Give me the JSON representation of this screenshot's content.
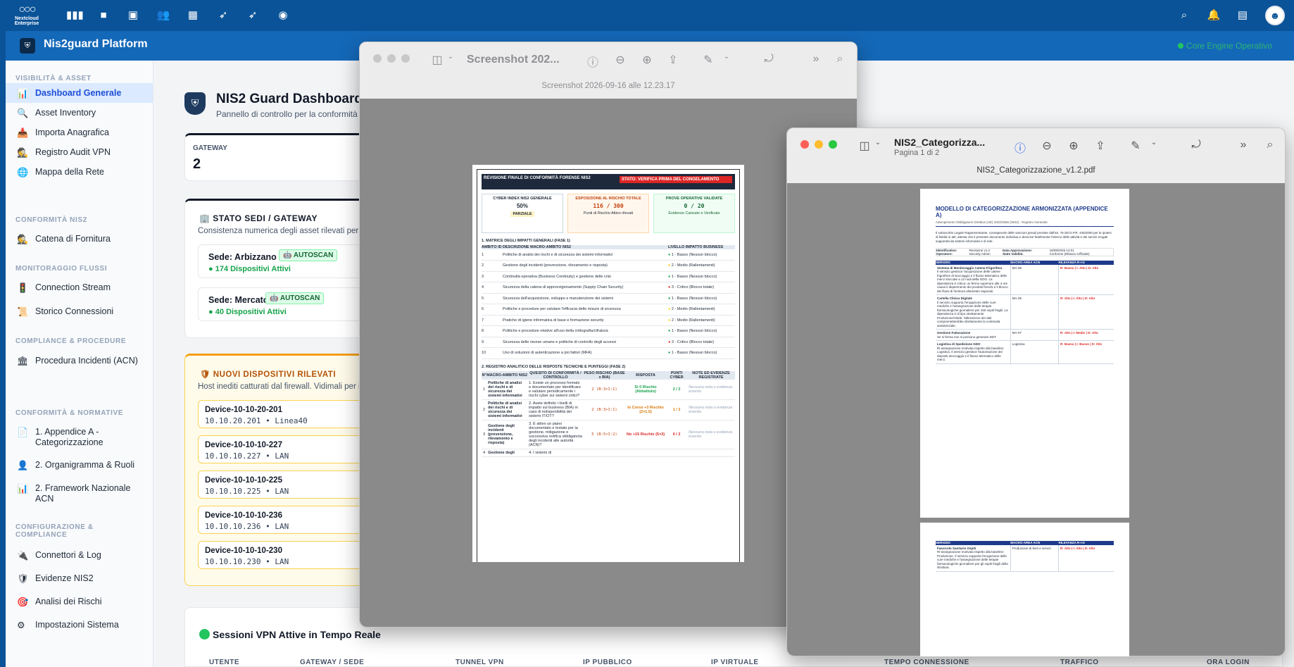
{
  "topbar": {
    "brand_line1": "Nextcloud",
    "brand_line2": "Enterprise"
  },
  "app": {
    "title": "Nis2guard Platform",
    "status": "Core Engine Operativo"
  },
  "sidebar": {
    "sections": [
      "VISIBILITÀ & ASSET",
      "CONFORMITÀ NIS2",
      "MONITORAGGIO FLUSSI",
      "COMPLIANCE & PROCEDURE",
      "CONFORMITÀ & NORMATIVE",
      "CONFIGURAZIONE & COMPLIANCE"
    ],
    "items": [
      "Dashboard Generale",
      "Asset Inventory",
      "Importa Anagrafica",
      "Registro Audit VPN",
      "Mappa della Rete",
      "Catena di Fornitura",
      "Connection Stream",
      "Storico Connessioni",
      "Procedura Incidenti (ACN)",
      "1. Appendice A - Categorizzazione",
      "2. Organigramma & Ruoli",
      "2. Framework Nazionale ACN",
      "Connettori & Log",
      "Evidenze NIS2",
      "Analisi dei Rischi",
      "Impostazioni Sistema"
    ]
  },
  "dashboard": {
    "title": "NIS2 Guard Dashboard",
    "subtitle": "Pannello di controllo per la conformità",
    "gateway_label": "GATEWAY",
    "gateway_value": "2",
    "stato_title": "STATO SEDI / GATEWAY",
    "stato_sub": "Consistenza numerica degli asset rilevati per o",
    "sedi": [
      {
        "name": "Sede: Arbizzano",
        "badge": "AUTOSCAN",
        "count": "174 Dispositivi Attivi"
      },
      {
        "name": "Sede: Mercato",
        "badge": "AUTOSCAN",
        "count": "40 Dispositivi Attivi"
      }
    ],
    "new_title": "NUOVI DISPOSITIVI RILEVATI",
    "new_sub": "Host inediti catturati dal firewall. Vidimali per i",
    "devices": [
      {
        "name": "Device-10-10-20-201",
        "ip": "10.10.20.201 • Linea40"
      },
      {
        "name": "Device-10-10-10-227",
        "ip": "10.10.10.227 • LAN"
      },
      {
        "name": "Device-10-10-10-225",
        "ip": "10.10.10.225 • LAN"
      },
      {
        "name": "Device-10-10-10-236",
        "ip": "10.10.10.236 • LAN"
      },
      {
        "name": "Device-10-10-10-230",
        "ip": "10.10.10.230 • LAN"
      }
    ],
    "vpn_title": "Sessioni VPN Attive in Tempo Reale",
    "vpn_cols": [
      "UTENTE",
      "GATEWAY / SEDE",
      "TUNNEL VPN",
      "IP PUBBLICO",
      "IP VIRTUALE",
      "TEMPO CONNESSIONE",
      "TRAFFICO",
      "ORA LOGIN"
    ]
  },
  "preview1": {
    "title": "Screenshot 202...",
    "subtitle": "Screenshot 2026-09-16 alle 12.23.17",
    "doc": {
      "header": "REVISIONE FINALE DI CONFORMITÀ FORENSE NIS2",
      "state": "STATO: VERIFICA PRIMA DEL CONGELAMENTO",
      "kpi": [
        {
          "title": "CYBER INDEX NIS2 GENERALE",
          "value": "50%",
          "note": "PARZIALE"
        },
        {
          "title": "ESPOSIZIONE AL RISCHIO TOTALE",
          "value": "116 / 300",
          "note": "Punti di Rischio Attivo rilevati"
        },
        {
          "title": "PROVE OPERATIVE VALIDATE",
          "value": "0 / 20",
          "note": "Evidenze Caricate e Verificate"
        }
      ],
      "s1_title": "1. MATRICE DEGLI IMPATTI GENERALI (FASE 1)",
      "s1_cols": [
        "AMBITO ID",
        "DESCRIZIONE MACRO-AMBITO NIS2",
        "LIVELLO IMPATTO BUSINESS"
      ],
      "s1_rows": [
        [
          "1",
          "Politiche di analisi dei rischi e di sicurezza dei sistemi informativi",
          "1 - Basso (Nessun blocco)"
        ],
        [
          "2",
          "Gestione degli incidenti (prevenzione, rilevamento e risposta)",
          "2 - Medio (Rallentamenti)"
        ],
        [
          "3",
          "Continuità operativa (Business Continuity) e gestione delle crisi",
          "1 - Basso (Nessun blocco)"
        ],
        [
          "4",
          "Sicurezza della catena di approvvigionamento (Supply Chain Security)",
          "3 - Critico (Blocco totale)"
        ],
        [
          "5",
          "Sicurezza dell'acquisizione, sviluppo e manutenzione dei sistemi",
          "1 - Basso (Nessun blocco)"
        ],
        [
          "6",
          "Politiche e procedure per valutare l'efficacia delle misure di sicurezza",
          "2 - Medio (Rallentamenti)"
        ],
        [
          "7",
          "Pratiche di igiene informatica di base e formazione security",
          "2 - Medio (Rallentamenti)"
        ],
        [
          "8",
          "Politiche e procedure relative all'uso della crittografia/cifratura",
          "1 - Basso (Nessun blocco)"
        ],
        [
          "9",
          "Sicurezza delle risorse umane e politiche di controllo degli accessi",
          "3 - Critico (Blocco totale)"
        ],
        [
          "10",
          "Uso di soluzioni di autenticazione a più fattori (MFA)",
          "1 - Basso (Nessun blocco)"
        ]
      ],
      "s2_title": "2. REGISTRO ANALITICO DELLE RISPOSTE TECNICHE E PUNTEGGI (FASE 2)",
      "s2_cols": [
        "N°",
        "MACRO-AMBITO NIS2",
        "QUESITO DI CONFORMITÀ / CONTROLLO",
        "PESO RISCHIO (BASE x BIA)",
        "RISPOSTA",
        "PUNTI CYBER",
        "NOTE ED EVIDENZE REGISTRATE"
      ],
      "s2_rows": [
        [
          "1",
          "Politiche di analisi dei rischi e di sicurezza dei sistemi informativi",
          "1. Esiste un processo formale e documentato per identificare e valutare periodicamente i rischi cyber sui sistemi critici?",
          "2 (B:3×I:1)",
          "Sì 0 Rischio (Abbattuto)",
          "2 / 2",
          "Nessuna nota o evidenza inserita"
        ],
        [
          "2",
          "Politiche di analisi dei rischi e di sicurezza dei sistemi informativi",
          "2. Avete definito i livelli di impatto sul business (BIA) in caso di indisponibilità dei sistemi IT/OT?",
          "2 (B:3×I:1)",
          "In Corso +3 Rischio (2×1.5)",
          "1 / 2",
          "Nessuna nota o evidenza inserita"
        ],
        [
          "3",
          "Gestione degli incidenti (prevenzione, rilevamento e risposta)",
          "3. È attivo un piano documentato e testato per la gestione, mitigazione e successiva notifica obbligatoria degli incidenti alle autorità (ACN)?",
          "5 (B:5×I:2)",
          "No +15 Rischio (5×3)",
          "0 / 2",
          "Nessuna nota o evidenza inserita"
        ],
        [
          "4",
          "Gestione degli",
          "4. I sistemi di",
          "",
          "",
          "",
          ""
        ]
      ]
    }
  },
  "preview2": {
    "title": "NIS2_Categorizza...",
    "subtitle": "Pagina 1 di 2",
    "filename": "NIS2_Categorizzazione_v1.2.pdf",
    "doc": {
      "title": "MODELLO DI CATEGORIZZAZIONE ARMONIZZATA (APPENDICE A)",
      "subtitle": "Adempimento Obbligatorio Direttiva (UE) 2022/2555 (NIS2) - Registro Generale",
      "intro": "Il sottoscritto Legale Rappresentante, consapevole delle sanzioni penali previste dall'art. 76 del D.P.R. 445/2000 per le ipotesi di falsità in atti, attesta che il presente documento individua e descrive fedelmente l'elenco delle attività e dei servizi erogati supportati da sistemi informativi e di rete.",
      "meta": [
        [
          "Identificativo:",
          "Revisione v1.2",
          "Data Approvazione:",
          "15/09/2026 14:01"
        ],
        [
          "Operatore:",
          "Security Admin",
          "Stato Validità:",
          "Conforme (Rilascio Ufficiale)"
        ]
      ],
      "cols": [
        "SERVIZIO",
        "MACRO-AREA ACN",
        "RILEVANZA R-I-D"
      ],
      "rows": [
        [
          "Sistema di Monitoraggio Catena Frigorifera",
          "Il servizio gestisce l'acquisizione delle catene frigorifere di stoccaggio e il flusso telematico delle merci stoccate a 12 nodi della GDO. La dipendenza è critica: un fermo superiore alle 4 ore causa il deperimento dei prodotti freschi e il blocco dei flussi di fornitura alimentari regionali.",
          "MA-06",
          "R: Basso | I: Alto | D: Alto"
        ],
        [
          "Cartella Clinica Digitale",
          "Il servizio supporta l'erogazione delle cure mediche e l'assegnazione delle terapie farmacologiche giornaliere per 150 ospiti fragili. La dipendenza è di tipo strettamente Produzione/Vitale: l'alterazione dei dati comprometterebbe direttamente la continuità assistenziale.",
          "MA-05",
          "R: Alto | I: Alto | D: Alto"
        ],
        [
          "Gestione Fatturazione",
          "Se si ferma non si possono generare DDT",
          "MA-07",
          "R: Alto | I: Medio | D: Alto"
        ],
        [
          "Logistica di Spedizione GDO",
          "Ri-assegnazione motivata rispetto alla baseline: Logistica. Il servizio gestisce l'automazione dei depositi stoccaggio e il flusso telematico delle merci.",
          "Logistica",
          "R: Basso | I: Basso | D: Alto"
        ]
      ],
      "rows_p2": [
        [
          "Fascicolo Sanitario Ospiti",
          "Ri-assegnazione motivata rispetto alla baseline: Produzione. Il servizio supporta l'erogazione delle cure mediche e l'assegnazione delle terapie farmacologiche giornaliere per gli ospiti fragili della struttura.",
          "Produzione di beni e servizi",
          "R: Alto | I: Alto | D: Alto"
        ]
      ]
    }
  },
  "colors": {
    "topbar": "#0a5398",
    "apphead": "#1468b8",
    "active": "#1d4ed8",
    "success": "#16a34a",
    "warning": "#b45309",
    "danger": "#dc2626"
  }
}
